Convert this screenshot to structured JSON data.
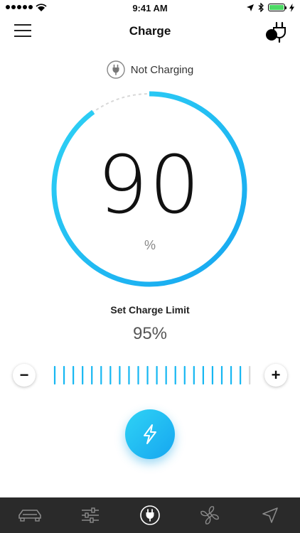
{
  "status_bar": {
    "time": "9:41 AM"
  },
  "nav": {
    "title": "Charge"
  },
  "charge_status": {
    "text": "Not Charging"
  },
  "gauge": {
    "value": "90",
    "unit": "%",
    "level_percent": 90
  },
  "charge_limit": {
    "label": "Set Charge Limit",
    "value": "95%",
    "limit_percent": 95,
    "tick_count": 22
  },
  "controls": {
    "minus": "−",
    "plus": "+"
  },
  "colors": {
    "accent": "#16b7f2",
    "accent_light": "#2fd3f5",
    "track_dashed": "#d8d8d8",
    "tab_bar_bg": "#2a2a2a",
    "tab_icon": "#8a8a8a",
    "tab_icon_active": "#ffffff",
    "battery": "#4cd964"
  },
  "tabs": [
    {
      "name": "car-tab",
      "icon": "car-icon",
      "active": false
    },
    {
      "name": "controls-tab",
      "icon": "sliders-icon",
      "active": false
    },
    {
      "name": "charge-tab",
      "icon": "plug-icon",
      "active": true
    },
    {
      "name": "climate-tab",
      "icon": "fan-icon",
      "active": false
    },
    {
      "name": "location-tab",
      "icon": "navigation-arrow-icon",
      "active": false
    }
  ]
}
